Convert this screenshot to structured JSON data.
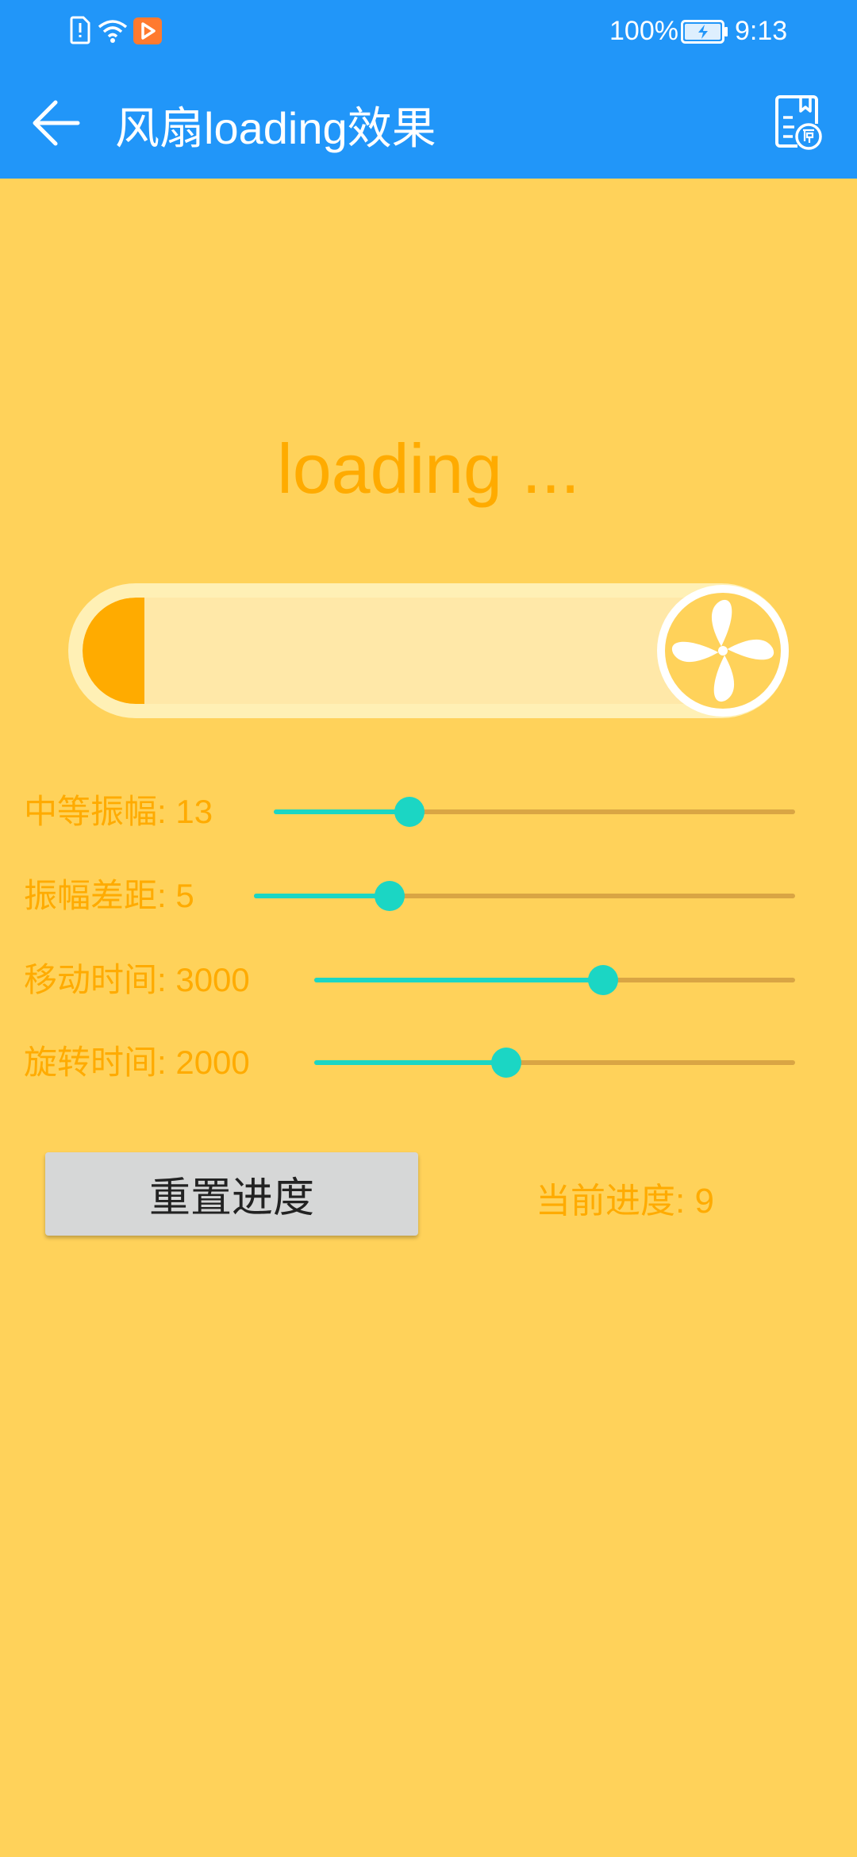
{
  "status_bar": {
    "battery": "100%",
    "time": "9:13",
    "icons": [
      "sim-alert-icon",
      "wifi-icon",
      "video-app-icon",
      "battery-charging-icon"
    ]
  },
  "app_bar": {
    "title": "风扇loading效果",
    "back_icon": "arrow-left-icon",
    "source_icon": "source-code-icon",
    "background": "#2196F9"
  },
  "loading": {
    "text": "loading ...",
    "progress": 9,
    "max": 100
  },
  "sliders": [
    {
      "label": "中等振幅: 13",
      "value_fraction": 0.26
    },
    {
      "label": "振幅差距: 5",
      "value_fraction": 0.25
    },
    {
      "label": "移动时间: 3000",
      "value_fraction": 0.6
    },
    {
      "label": "旋转时间: 2000",
      "value_fraction": 0.4
    }
  ],
  "reset_button": {
    "label": "重置进度"
  },
  "current_progress": {
    "label": "当前进度: 9"
  },
  "colors": {
    "background": "#FFD25A",
    "accent_orange": "#FFAB00",
    "slider_teal": "#1BD6C4"
  }
}
